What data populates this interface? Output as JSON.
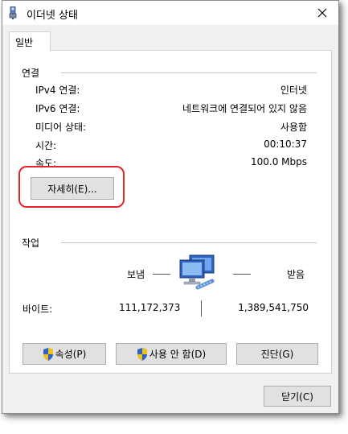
{
  "window": {
    "title": "이더넷 상태",
    "title_icon": "network-adapter-icon",
    "close_icon": "close-icon"
  },
  "tabs": [
    {
      "label": "일반",
      "selected": true
    }
  ],
  "connection": {
    "section_label": "연결",
    "rows": [
      {
        "label": "IPv4 연결:",
        "value": "인터넷"
      },
      {
        "label": "IPv6 연결:",
        "value": "네트워크에 연결되어 있지 않음"
      },
      {
        "label": "미디어 상태:",
        "value": "사용함"
      },
      {
        "label": "시간:",
        "value": "00:10:37"
      },
      {
        "label": "속도:",
        "value": "100.0 Mbps"
      }
    ],
    "details_button": "자세히(E)..."
  },
  "activity": {
    "section_label": "작업",
    "sent_label": "보냄",
    "received_label": "받음",
    "bytes_label": "바이트:",
    "bytes_sent": "111,172,373",
    "bytes_received": "1,389,541,750"
  },
  "actions": {
    "properties": "속성(P)",
    "disable": "사용 안 함(D)",
    "diagnose": "진단(G)"
  },
  "footer": {
    "close": "닫기(C)"
  },
  "colors": {
    "highlight": "#e8232a",
    "shield_blue": "#2d62c8",
    "shield_yellow": "#f2c21b"
  }
}
